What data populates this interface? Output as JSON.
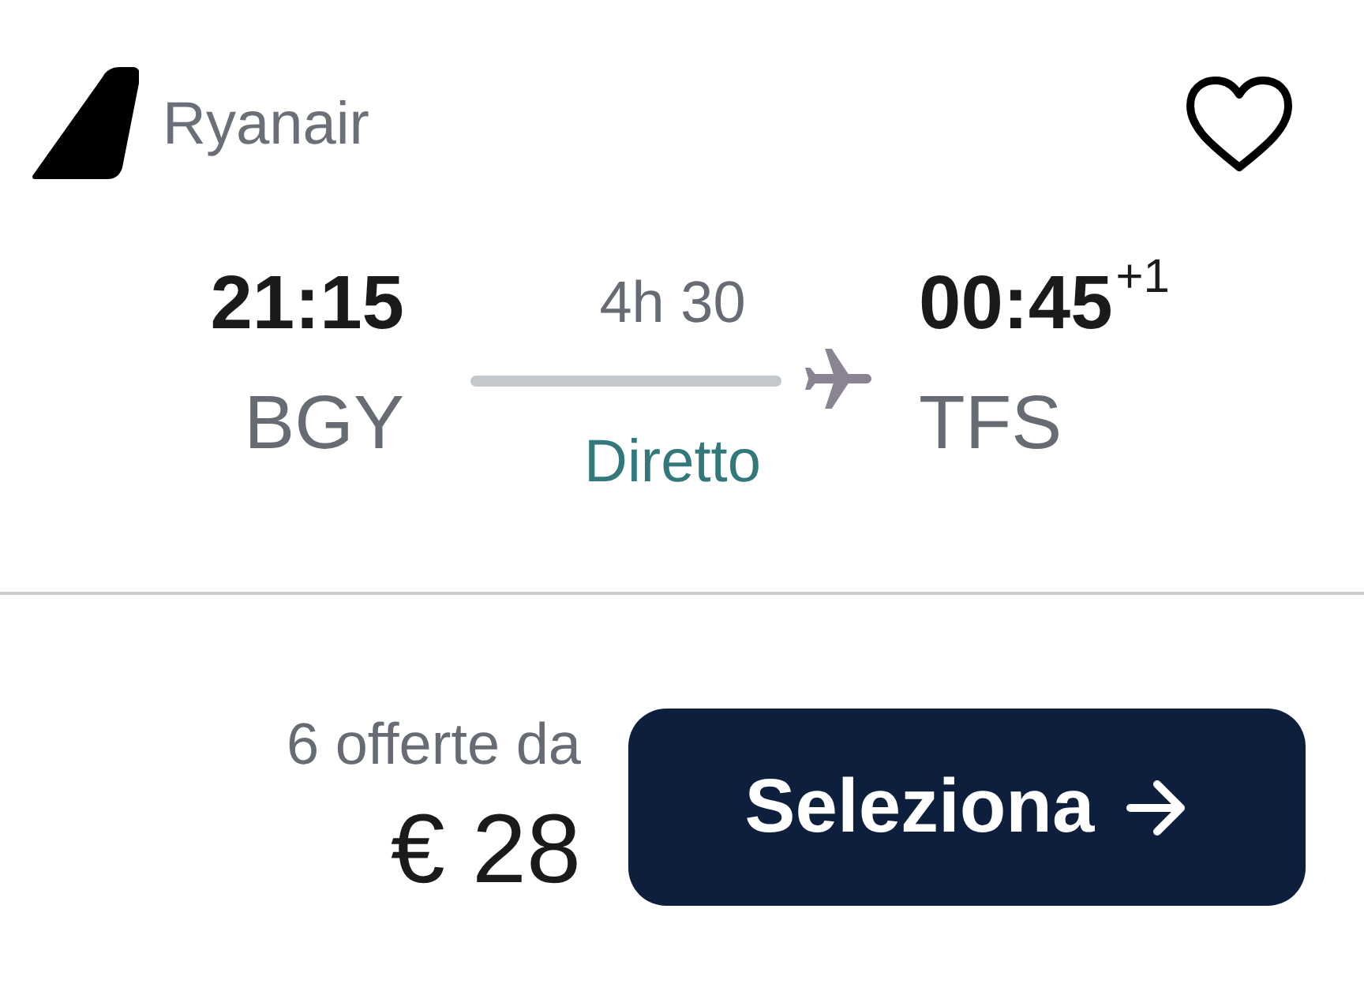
{
  "airline": {
    "name": "Ryanair"
  },
  "favorite": {
    "saved": false
  },
  "departure": {
    "time": "21:15",
    "airport": "BGY"
  },
  "duration": "4h 30",
  "stops": "Diretto",
  "arrival": {
    "time": "00:45",
    "day_offset": "+1",
    "airport": "TFS"
  },
  "offers": {
    "label": "6 offerte da",
    "price": "€ 28"
  },
  "select_button": {
    "label": "Seleziona"
  }
}
